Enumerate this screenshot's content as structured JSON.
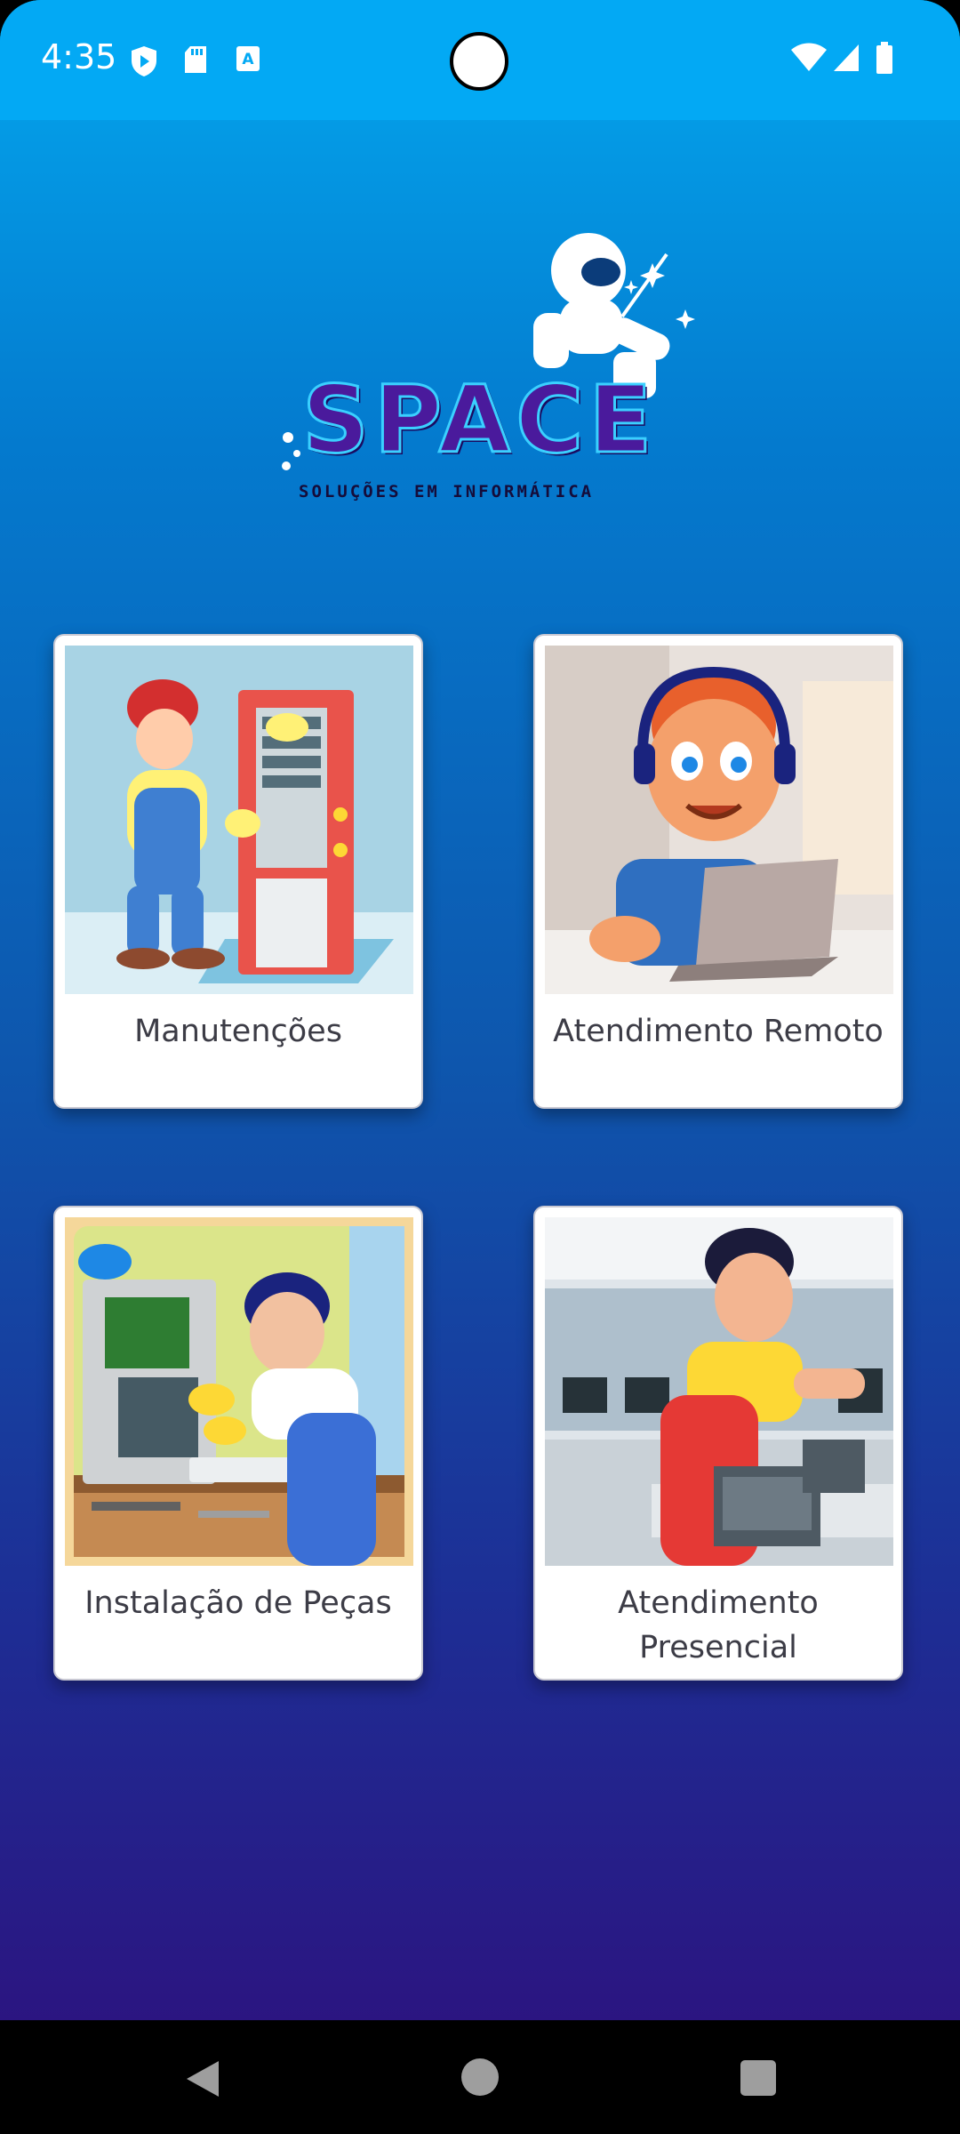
{
  "status_bar": {
    "time": "4:35",
    "left_icons": [
      "shield-play-icon",
      "sd-card-icon",
      "text-a-icon"
    ],
    "right_icons": [
      "wifi-icon",
      "cell-signal-icon",
      "battery-icon"
    ]
  },
  "brand": {
    "name": "SPACE",
    "tagline": "SOLUÇÕES EM INFORMÁTICA",
    "logo_icon": "astronaut-laptop-icon"
  },
  "services": [
    {
      "label": "Manutenções",
      "image": "technician-repairing-computer"
    },
    {
      "label": "Atendimento Remoto",
      "image": "support-agent-headset-laptop"
    },
    {
      "label": "Instalação de Peças",
      "image": "technician-installing-parts"
    },
    {
      "label": "Atendimento Presencial",
      "image": "technician-onsite-office"
    }
  ],
  "nav_bar": {
    "buttons": [
      "back-icon",
      "home-icon",
      "recents-icon"
    ]
  },
  "colors": {
    "status_bar": "#03a9f4",
    "gradient_top": "#04a7ee",
    "gradient_bottom": "#2b1581",
    "card_bg": "#ffffff",
    "card_text": "#3c3c46"
  }
}
